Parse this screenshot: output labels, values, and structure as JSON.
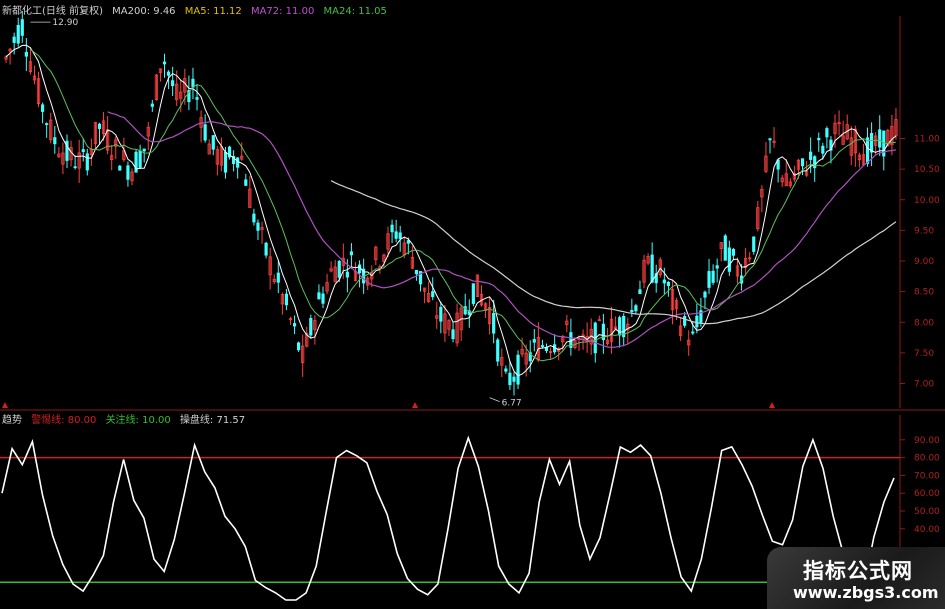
{
  "header_main": {
    "stock_name": "新都化工(日线 前复权)",
    "ma200": "MA200: 9.46",
    "ma5": "MA5: 11.12",
    "ma72": "MA72: 11.00",
    "ma24": "MA24: 11.05"
  },
  "header_indicator": {
    "name": "趋势",
    "warning": "警惕线: 80.00",
    "attention": "关注线: 10.00",
    "operation": "操盘线: 71.57"
  },
  "annotations": {
    "high": "12.90",
    "low": "6.77"
  },
  "watermark": {
    "title": "指标公式网",
    "url": "www.zbgs3.com"
  },
  "colors": {
    "background": "#000000",
    "grid": "#8b1a1a",
    "axis_text": "#b02020",
    "up_candle": "#ff4040",
    "down_candle": "#40ffff",
    "ma5": "#ffffff",
    "ma24": "#5ac05a",
    "ma72": "#b050c0",
    "ma200": "#d0d0d0",
    "indicator_line": "#ffffff",
    "warning_line": "#d02020",
    "attention_line": "#30c030",
    "header_yellow": "#e0c000"
  },
  "chart_data": [
    {
      "type": "candlestick",
      "title": "新都化工(日线 前复权)",
      "ylim": [
        6.6,
        13.0
      ],
      "y_ticks": [
        "11.00",
        "10.50",
        "10.00",
        "9.50",
        "9.00",
        "8.50",
        "8.00",
        "7.50",
        "7.00"
      ],
      "series": [
        {
          "name": "MA5",
          "value": 11.12
        },
        {
          "name": "MA24",
          "value": 11.05
        },
        {
          "name": "MA72",
          "value": 11.0
        },
        {
          "name": "MA200",
          "value": 9.46
        }
      ],
      "close_path": [
        12.3,
        12.9,
        11.8,
        11.0,
        10.7,
        10.6,
        11.2,
        10.8,
        10.5,
        10.9,
        12.4,
        11.6,
        11.9,
        10.9,
        10.6,
        10.8,
        9.6,
        8.9,
        8.2,
        7.4,
        8.3,
        8.9,
        9.0,
        8.8,
        9.1,
        9.5,
        9.1,
        8.4,
        8.0,
        7.9,
        8.6,
        8.2,
        7.0,
        7.3,
        7.6,
        7.7,
        7.8,
        7.6,
        7.8,
        7.9,
        8.1,
        8.9,
        8.8,
        8.1,
        7.7,
        8.6,
        9.2,
        8.8,
        9.4,
        11.0,
        10.2,
        10.5,
        10.8,
        11.1,
        11.0,
        10.8,
        10.9,
        11.12
      ],
      "lows": [
        {
          "label": "6.77",
          "value": 6.77
        }
      ],
      "highs": [
        {
          "label": "12.90",
          "value": 12.9
        }
      ]
    },
    {
      "type": "line",
      "title": "趋势",
      "ylim": [
        0,
        100
      ],
      "y_ticks": [
        "90.00",
        "80.00",
        "70.00",
        "60.00",
        "50.00",
        "40.00"
      ],
      "reference_lines": [
        {
          "name": "警惕线",
          "value": 80.0
        },
        {
          "name": "关注线",
          "value": 10.0
        }
      ],
      "series": [
        {
          "name": "操盘线",
          "last": 71.57,
          "values": [
            60,
            88,
            76,
            89,
            62,
            36,
            20,
            12,
            5,
            14,
            28,
            55,
            79,
            59,
            46,
            23,
            19,
            34,
            60,
            90,
            72,
            63,
            50,
            40,
            30,
            14,
            7,
            4,
            2,
            0,
            4,
            22,
            50,
            80,
            87,
            81,
            77,
            64,
            48,
            26,
            15,
            6,
            3,
            12,
            40,
            74,
            94,
            75,
            50,
            22,
            9,
            4,
            18,
            55,
            79,
            68,
            78,
            42,
            26,
            35,
            60,
            89,
            83,
            87,
            84,
            60,
            35,
            16,
            5,
            23,
            55,
            84,
            86,
            79,
            64,
            48,
            36,
            31,
            45,
            78,
            90,
            74,
            50,
            26,
            15,
            9,
            35,
            55,
            71.57
          ]
        }
      ]
    }
  ]
}
